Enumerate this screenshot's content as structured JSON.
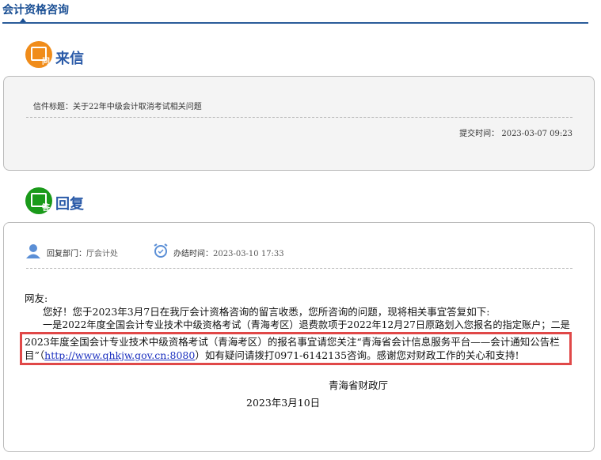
{
  "header": {
    "title": "会计资格咨询"
  },
  "letter": {
    "section_title": "来信",
    "icon_text": "问",
    "subject_label": "信件标题：",
    "subject": "关于22年中级会计取消考试相关问题",
    "submit_label": "提交时间：",
    "submit_time": "2023-03-07 09:23"
  },
  "reply": {
    "section_title": "回复",
    "icon_text": "答",
    "dept_label": "回复部门：",
    "dept": "厅会计处",
    "done_label": "办结时间：",
    "done_time": "2023-03-10 17:33",
    "greeting": "网友:",
    "p1": "您好！您于2023年3月7日在我厅会计资格咨询的留言收悉，您所咨询的问题，现将相关事宜答复如下:",
    "p2a": "一是2022年度全国会计专业技术中级资格考试（青海考区）退费款项于2022年12月27日原路划入您报名的指定账户；二是",
    "p2b": "2023年度全国会计专业技术中级资格考试（青海考区）的报名事宜请您关注“青海省会计信息服务平台——会计通知公告栏目”（",
    "link": "http://www.qhkjw.gov.cn:8080",
    "p2c": "）如有疑问请拨打0971-6142135咨询。感谢您对财政工作的关心和支持!",
    "signature": "青海省财政厅",
    "date": "2023年3月10日"
  }
}
